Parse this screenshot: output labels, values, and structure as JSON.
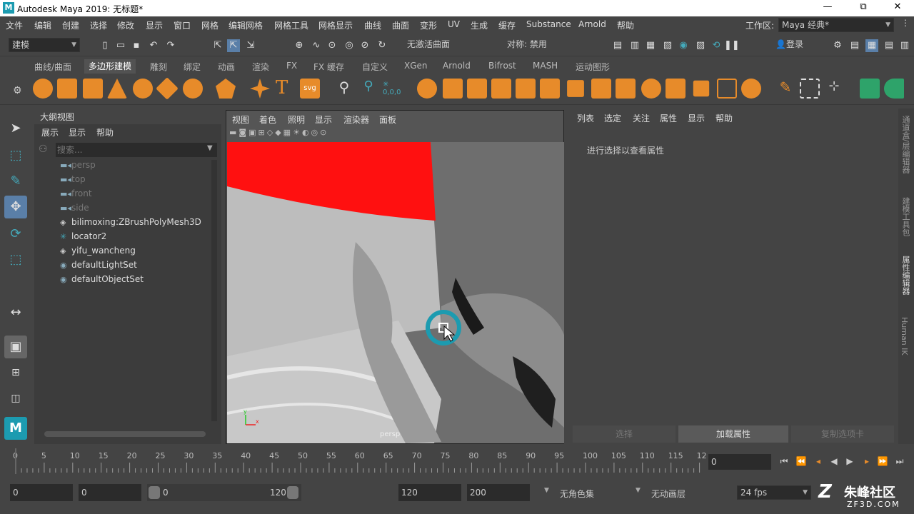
{
  "titlebar": {
    "title": "Autodesk Maya 2019: 无标题*",
    "logo": "M",
    "minimize": "—",
    "restore": "⧉",
    "close": "✕"
  },
  "menu": [
    "文件",
    "编辑",
    "创建",
    "选择",
    "修改",
    "显示",
    "窗口",
    "网格",
    "编辑网格",
    "网格工具",
    "网格显示",
    "曲线",
    "曲面",
    "变形",
    "UV",
    "生成",
    "缓存",
    "Substance",
    "Arnold",
    "帮助"
  ],
  "workspace": {
    "label": "工作区:",
    "value": "Maya 经典*"
  },
  "statusline": {
    "mode": "建模",
    "live_surface": "无激活曲面",
    "symmetry": "对称: 禁用",
    "login": "登录"
  },
  "shelf_tabs": [
    "曲线/曲面",
    "多边形建模",
    "雕刻",
    "绑定",
    "动画",
    "渲染",
    "FX",
    "FX 缓存",
    "自定义",
    "XGen",
    "Arnold",
    "Bifrost",
    "MASH",
    "运动图形"
  ],
  "shelf_active_tab": "多边形建模",
  "outliner": {
    "title": "大纲视图",
    "menus": [
      "展示",
      "显示",
      "帮助"
    ],
    "search_placeholder": "搜索...",
    "items": [
      {
        "label": "persp",
        "icon": "camera-icon",
        "dim": true
      },
      {
        "label": "top",
        "icon": "camera-icon",
        "dim": true
      },
      {
        "label": "front",
        "icon": "camera-icon",
        "dim": true
      },
      {
        "label": "side",
        "icon": "camera-icon",
        "dim": true
      },
      {
        "label": "bilimoxing:ZBrushPolyMesh3D",
        "icon": "mesh-icon",
        "dim": false
      },
      {
        "label": "locator2",
        "icon": "locator-icon",
        "dim": false
      },
      {
        "label": "yifu_wancheng",
        "icon": "mesh-icon",
        "dim": false
      },
      {
        "label": "defaultLightSet",
        "icon": "set-icon",
        "dim": false
      },
      {
        "label": "defaultObjectSet",
        "icon": "set-icon",
        "dim": false
      }
    ]
  },
  "viewport": {
    "menus": [
      "视图",
      "着色",
      "照明",
      "显示",
      "渲染器",
      "面板"
    ],
    "camera_label": "persp",
    "axis_y": "y",
    "axis_x": "x"
  },
  "attribute_editor": {
    "menus": [
      "列表",
      "选定",
      "关注",
      "属性",
      "显示",
      "帮助"
    ],
    "message": "进行选择以查看属性",
    "buttons": [
      "选择",
      "加载属性",
      "复制选项卡"
    ]
  },
  "right_tabs": [
    "通道盒/层编辑器",
    "建模工具包",
    "属性编辑器",
    "Human IK"
  ],
  "timeline": {
    "ticks": [
      "0",
      "5",
      "10",
      "15",
      "20",
      "25",
      "30",
      "35",
      "40",
      "45",
      "50",
      "55",
      "60",
      "65",
      "70",
      "75",
      "80",
      "85",
      "90",
      "95",
      "100",
      "105",
      "110",
      "115",
      "12"
    ],
    "current_frame": "0"
  },
  "range": {
    "start": "0",
    "playback_start": "0",
    "slider_start": "0",
    "slider_end": "120",
    "playback_end": "120",
    "end": "200",
    "character_set": "无角色集",
    "anim_layer": "无动画层",
    "fps": "24 fps"
  },
  "watermark": {
    "brand": "朱峰社区",
    "url": "ZF3D.COM"
  },
  "colors": {
    "accent": "#1c9bb0",
    "orange": "#e78b2a",
    "red_object": "#ff1010"
  }
}
